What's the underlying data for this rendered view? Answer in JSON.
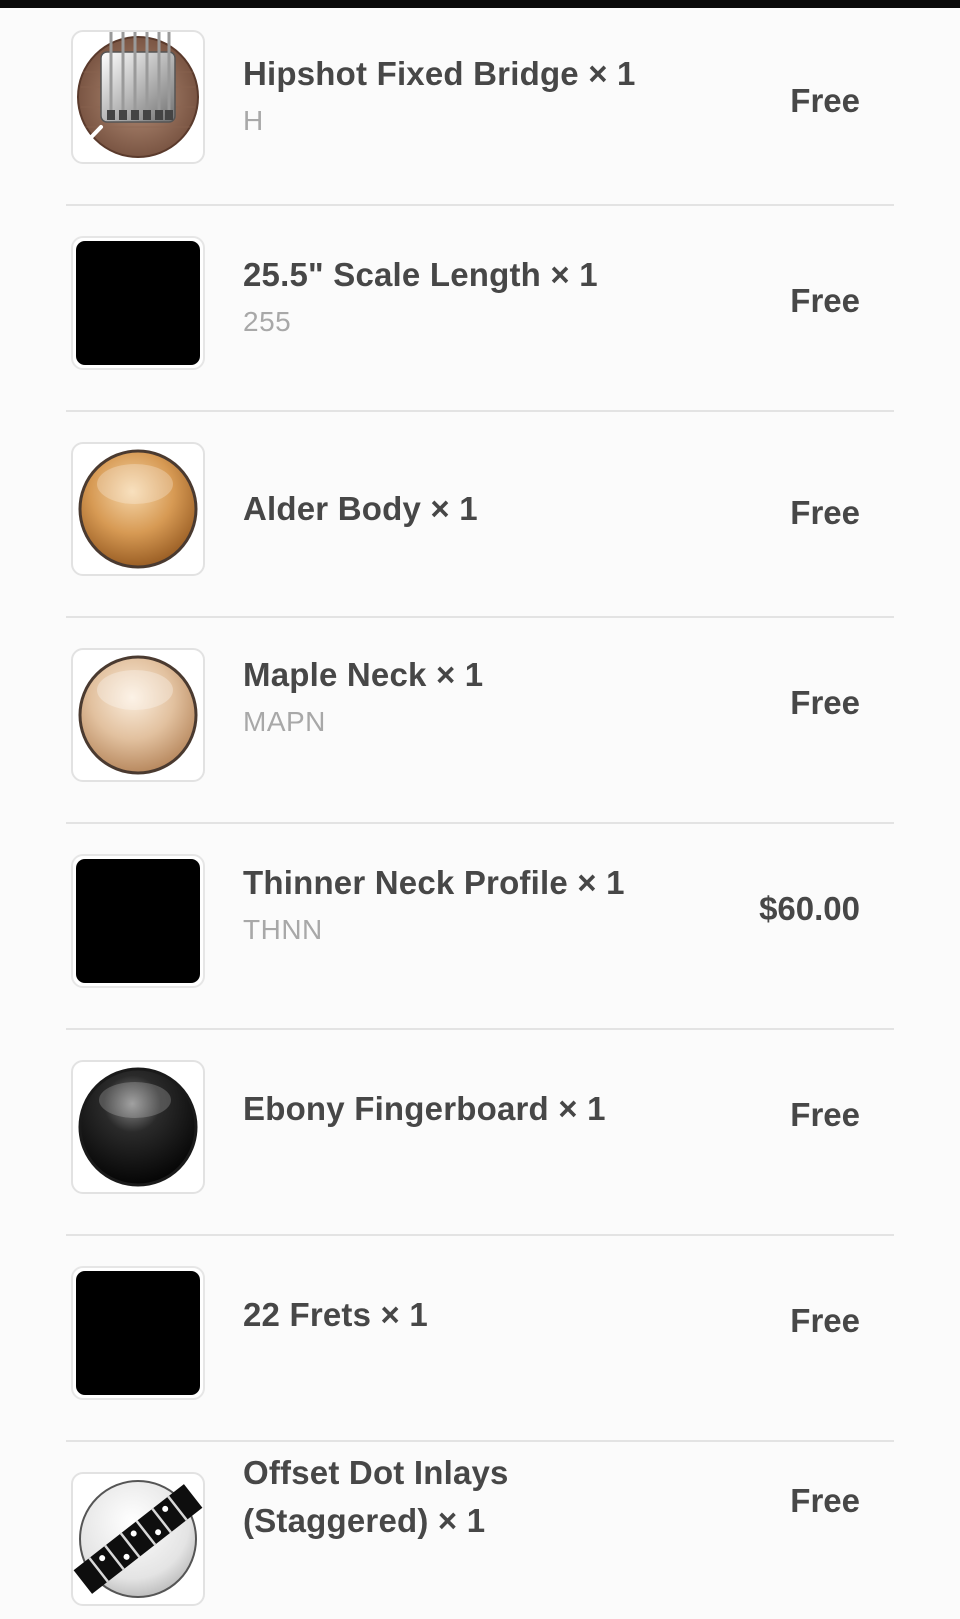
{
  "items": [
    {
      "name": "Hipshot Fixed Bridge × 1",
      "sku": "H",
      "price": "Free",
      "icon": "bridge-icon"
    },
    {
      "name": "25.5\" Scale Length × 1",
      "sku": "255",
      "price": "Free",
      "icon": "black-swatch"
    },
    {
      "name": "Alder Body × 1",
      "sku": "",
      "price": "Free",
      "icon": "alder-wood-swatch"
    },
    {
      "name": "Maple Neck × 1",
      "sku": "MAPN",
      "price": "Free",
      "icon": "maple-wood-swatch"
    },
    {
      "name": "Thinner Neck Profile × 1",
      "sku": "THNN",
      "price": "$60.00",
      "icon": "black-swatch"
    },
    {
      "name": "Ebony Fingerboard × 1",
      "sku": "",
      "price": "Free",
      "icon": "ebony-wood-swatch"
    },
    {
      "name": "22 Frets × 1",
      "sku": "",
      "price": "Free",
      "icon": "black-swatch"
    },
    {
      "name": "Offset Dot Inlays",
      "name_line2": "(Staggered) × 1",
      "sku": "",
      "price": "Free",
      "icon": "fretboard-inlay-icon"
    }
  ],
  "colors": {
    "text": "#474747",
    "sku": "#a8a8a8",
    "separator": "#e3e3e3",
    "background": "#fbfbfb"
  }
}
